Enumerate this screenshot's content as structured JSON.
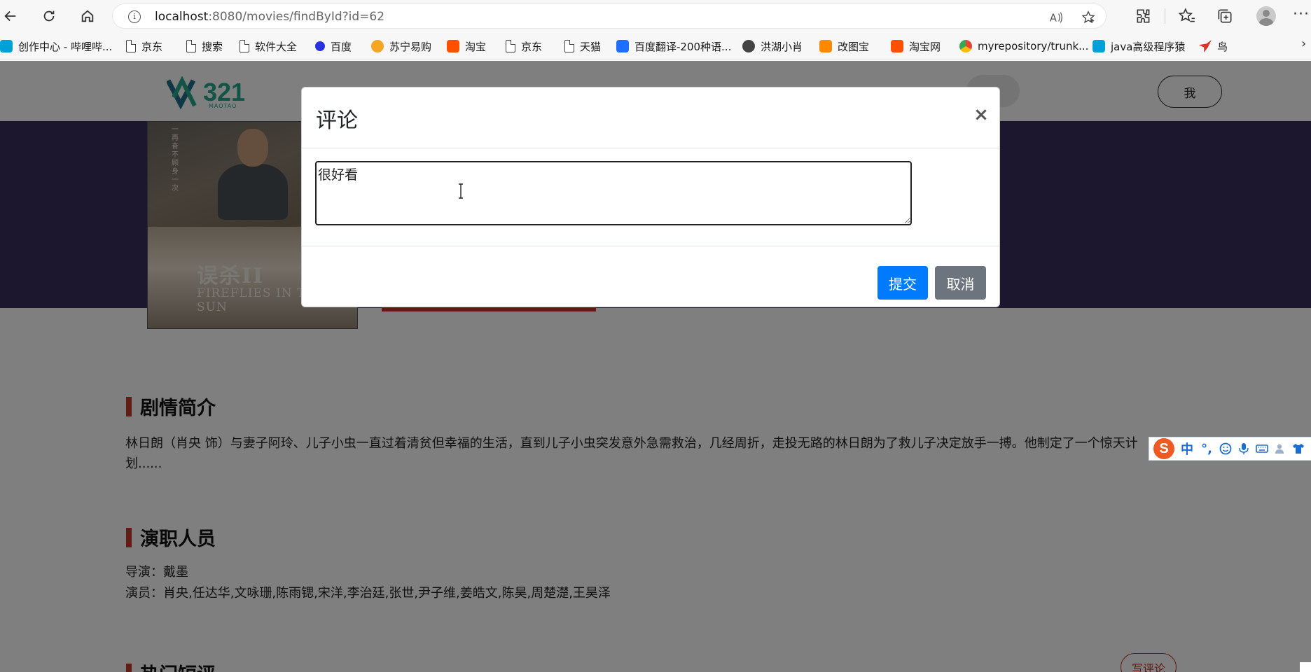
{
  "browser": {
    "url_host": "localhost",
    "url_path": ":8080/movies/findById?id=62",
    "bookmarks": [
      {
        "label": "创作中心 - 哔哩哔...",
        "icon": "bilibili-tv-icon",
        "color": "#00a1d6"
      },
      {
        "label": "京东",
        "icon": "page-icon"
      },
      {
        "label": "搜索",
        "icon": "page-icon"
      },
      {
        "label": "软件大全",
        "icon": "page-icon"
      },
      {
        "label": "百度",
        "icon": "baidu-paw-icon",
        "color": "#2932e1"
      },
      {
        "label": "苏宁易购",
        "icon": "suning-icon",
        "color": "#f5a623"
      },
      {
        "label": "淘宝",
        "icon": "taobao-icon",
        "color": "#ff5000"
      },
      {
        "label": "京东",
        "icon": "page-icon"
      },
      {
        "label": "天猫",
        "icon": "page-icon"
      },
      {
        "label": "百度翻译-200种语...",
        "icon": "baidu-translate-icon",
        "color": "#1e6fff"
      },
      {
        "label": "洪湖小肖",
        "icon": "hongmeng-icon",
        "color": "#444444"
      },
      {
        "label": "改图宝",
        "icon": "gaitubao-icon",
        "color": "#ff8a00"
      },
      {
        "label": "淘宝网",
        "icon": "taobao-icon",
        "color": "#ff5000"
      },
      {
        "label": "myrepository/trunk...",
        "icon": "chrome-icon",
        "color": "#34a853"
      },
      {
        "label": "java高级程序猿",
        "icon": "bilibili-tv-icon",
        "color": "#00a1d6"
      },
      {
        "label": "鸟",
        "icon": "bird-icon",
        "color": "#e0322b"
      }
    ]
  },
  "site": {
    "logo_text": "321",
    "logo_sub": "MAOTAO",
    "me_label": "我",
    "poster_title": "误杀II",
    "poster_subtitle": "FIREFLIES IN THE SUN",
    "poster_vertical": "一再奋不顾身一次",
    "plot_heading": "剧情简介",
    "plot_text": "林日朗（肖央 饰）与妻子阿玲、儿子小虫一直过着清贫但幸福的生活，直到儿子小虫突发意外急需救治，几经周折，走投无路的林日朗为了救儿子决定放手一搏。他制定了一个惊天计划......",
    "cast_heading": "演职人员",
    "director_line": "导演：戴墨",
    "actors_line": "演员：肖央,任达华,文咏珊,陈雨锶,宋洋,李治廷,张世,尹子维,姜皓文,陈昊,周楚濋,王昊泽",
    "reviews_heading": "热门短评",
    "write_review_label": "写评论"
  },
  "modal": {
    "title": "评论",
    "close_label": "×",
    "comment_value": "很好看",
    "submit_label": "提交",
    "cancel_label": "取消"
  },
  "ime": {
    "logo": "S",
    "mode": "中",
    "punct": "°,"
  },
  "colors": {
    "banner": "#392d5c",
    "accent_red": "#c4302b",
    "primary": "#007bff",
    "secondary": "#6c757d",
    "logo_green": "#27a88e"
  }
}
